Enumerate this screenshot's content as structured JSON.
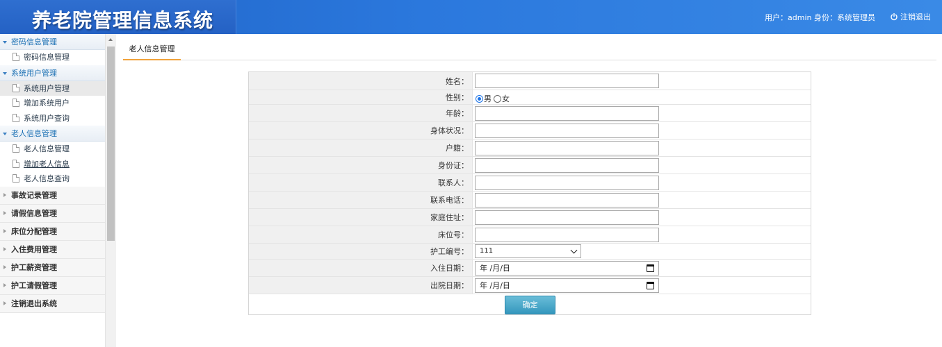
{
  "header": {
    "title": "养老院管理信息系统",
    "user_label": "用户：",
    "user_name": "admin",
    "role_label": "身份：",
    "role": "系统管理员",
    "logout": "注销退出"
  },
  "sidebar": {
    "groups": [
      {
        "label": "密码信息管理",
        "items": [
          {
            "label": "密码信息管理"
          }
        ]
      },
      {
        "label": "系统用户管理",
        "items": [
          {
            "label": "系统用户管理"
          },
          {
            "label": "增加系统用户"
          },
          {
            "label": "系统用户查询"
          }
        ]
      },
      {
        "label": "老人信息管理",
        "items": [
          {
            "label": "老人信息管理"
          },
          {
            "label": "增加老人信息"
          },
          {
            "label": "老人信息查询"
          }
        ]
      }
    ],
    "collapsed": [
      {
        "label": "事故记录管理"
      },
      {
        "label": "请假信息管理"
      },
      {
        "label": "床位分配管理"
      },
      {
        "label": "入住费用管理"
      },
      {
        "label": "护工薪资管理"
      },
      {
        "label": "护工请假管理"
      },
      {
        "label": "注销退出系统"
      }
    ]
  },
  "tab": {
    "label": "老人信息管理"
  },
  "form": {
    "name_label": "姓名：",
    "gender_label": "性别：",
    "gender_male": "男",
    "gender_female": "女",
    "age_label": "年龄：",
    "health_label": "身体状况：",
    "household_label": "户籍：",
    "idcard_label": "身份证：",
    "contact_label": "联系人：",
    "phone_label": "联系电话：",
    "address_label": "家庭住址：",
    "bed_label": "床位号：",
    "caregiver_label": "护工编号：",
    "caregiver_value": "111",
    "checkin_label": "入住日期：",
    "checkin_value": "年 /月/日",
    "checkout_label": "出院日期：",
    "checkout_value": "年 /月/日",
    "submit": "确定"
  }
}
